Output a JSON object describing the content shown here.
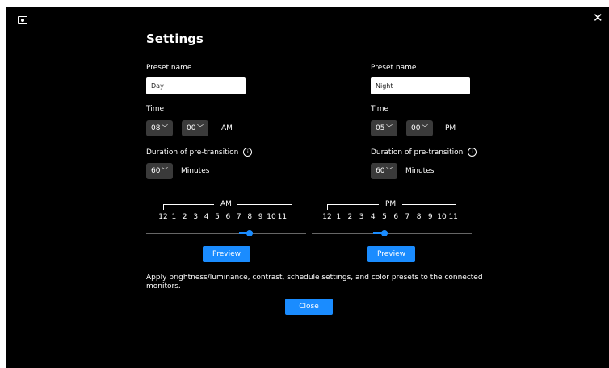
{
  "dialog": {
    "title": "Settings",
    "close_icon": "close-icon",
    "description": "Apply brightness/luminance, contrast, schedule settings, and color presets to the connected monitors.",
    "close_label": "Close"
  },
  "day": {
    "preset_label": "Preset name",
    "preset_value": "Day",
    "time_label": "Time",
    "hour": "08",
    "minute": "00",
    "period": "AM",
    "duration_label": "Duration of pre-transition",
    "duration": "60",
    "duration_unit": "Minutes",
    "scale_label": "AM",
    "ticks": [
      "12",
      "1",
      "2",
      "3",
      "4",
      "5",
      "6",
      "7",
      "8",
      "9",
      "10",
      "11"
    ],
    "preview_label": "Preview",
    "slider_start_hour": 7,
    "slider_end_hour": 8
  },
  "night": {
    "preset_label": "Preset name",
    "preset_value": "Night",
    "time_label": "Time",
    "hour": "05",
    "minute": "00",
    "period": "PM",
    "duration_label": "Duration of pre-transition",
    "duration": "60",
    "duration_unit": "Minutes",
    "scale_label": "PM",
    "ticks": [
      "12",
      "1",
      "2",
      "3",
      "4",
      "5",
      "6",
      "7",
      "8",
      "9",
      "10",
      "11"
    ],
    "preview_label": "Preview",
    "slider_start_hour": 4,
    "slider_end_hour": 5
  },
  "colors": {
    "accent": "#1a8cff",
    "background": "#000000",
    "dropdown": "#3a3a3a"
  }
}
